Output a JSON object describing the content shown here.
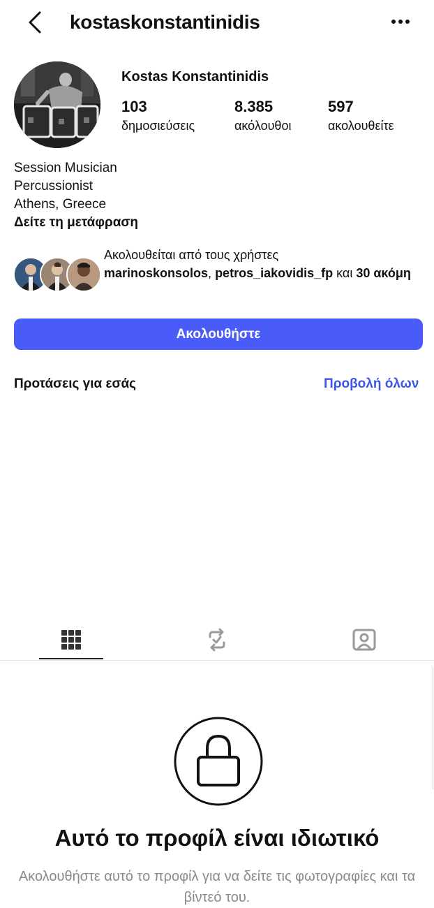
{
  "header": {
    "username": "kostaskonstantinidis",
    "back_icon": "chevron-left-icon",
    "more_icon": "more-horizontal-icon"
  },
  "profile": {
    "full_name": "Kostas Konstantinidis",
    "stats": {
      "posts": {
        "value": "103",
        "label": "δημοσιεύσεις"
      },
      "followers": {
        "value": "8.385",
        "label": "ακόλουθοι"
      },
      "following": {
        "value": "597",
        "label": "ακολουθείτε"
      }
    },
    "bio": [
      "Session Musician",
      "Percussionist",
      "Athens, Greece"
    ],
    "translate_label": "Δείτε τη μετάφραση"
  },
  "followed_by": {
    "prefix": "Ακολουθείται από τους χρήστες",
    "user1": "marinoskonsolos",
    "separator": ", ",
    "user2": "petros_iakovidis_fp",
    "conjunction": " και ",
    "count_text": "30 ακόμη"
  },
  "actions": {
    "follow_label": "Ακολουθήστε"
  },
  "suggestions": {
    "title": "Προτάσεις για εσάς",
    "see_all": "Προβολή όλων"
  },
  "tabs": [
    {
      "name": "posts-grid",
      "icon": "grid-icon",
      "active": true
    },
    {
      "name": "reposts",
      "icon": "repost-icon",
      "active": false
    },
    {
      "name": "tagged",
      "icon": "tagged-person-icon",
      "active": false
    }
  ],
  "private_account": {
    "icon": "lock-icon",
    "title": "Αυτό το προφίλ είναι ιδιωτικό",
    "description": "Ακολουθήστε αυτό το προφίλ για να δείτε τις φωτογραφίες και τα βίντεό του."
  },
  "colors": {
    "accent": "#4a5cf7",
    "link": "#3b55e6",
    "muted_text": "#8a8a8a"
  }
}
